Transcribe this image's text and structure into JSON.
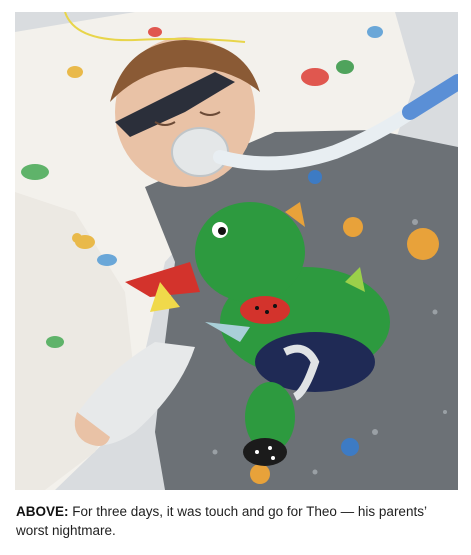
{
  "photo": {
    "subject": "child-in-hospital-bed-with-plush-dragon"
  },
  "caption": {
    "label": "ABOVE:",
    "text": " For three days, it was touch and go for Theo — his parents’ worst nightmare."
  },
  "colors": {
    "blanket": "#6c7176",
    "plush_green": "#2d9a3f",
    "sheet": "#f3f1ec",
    "tubing": "#e8eef2"
  }
}
